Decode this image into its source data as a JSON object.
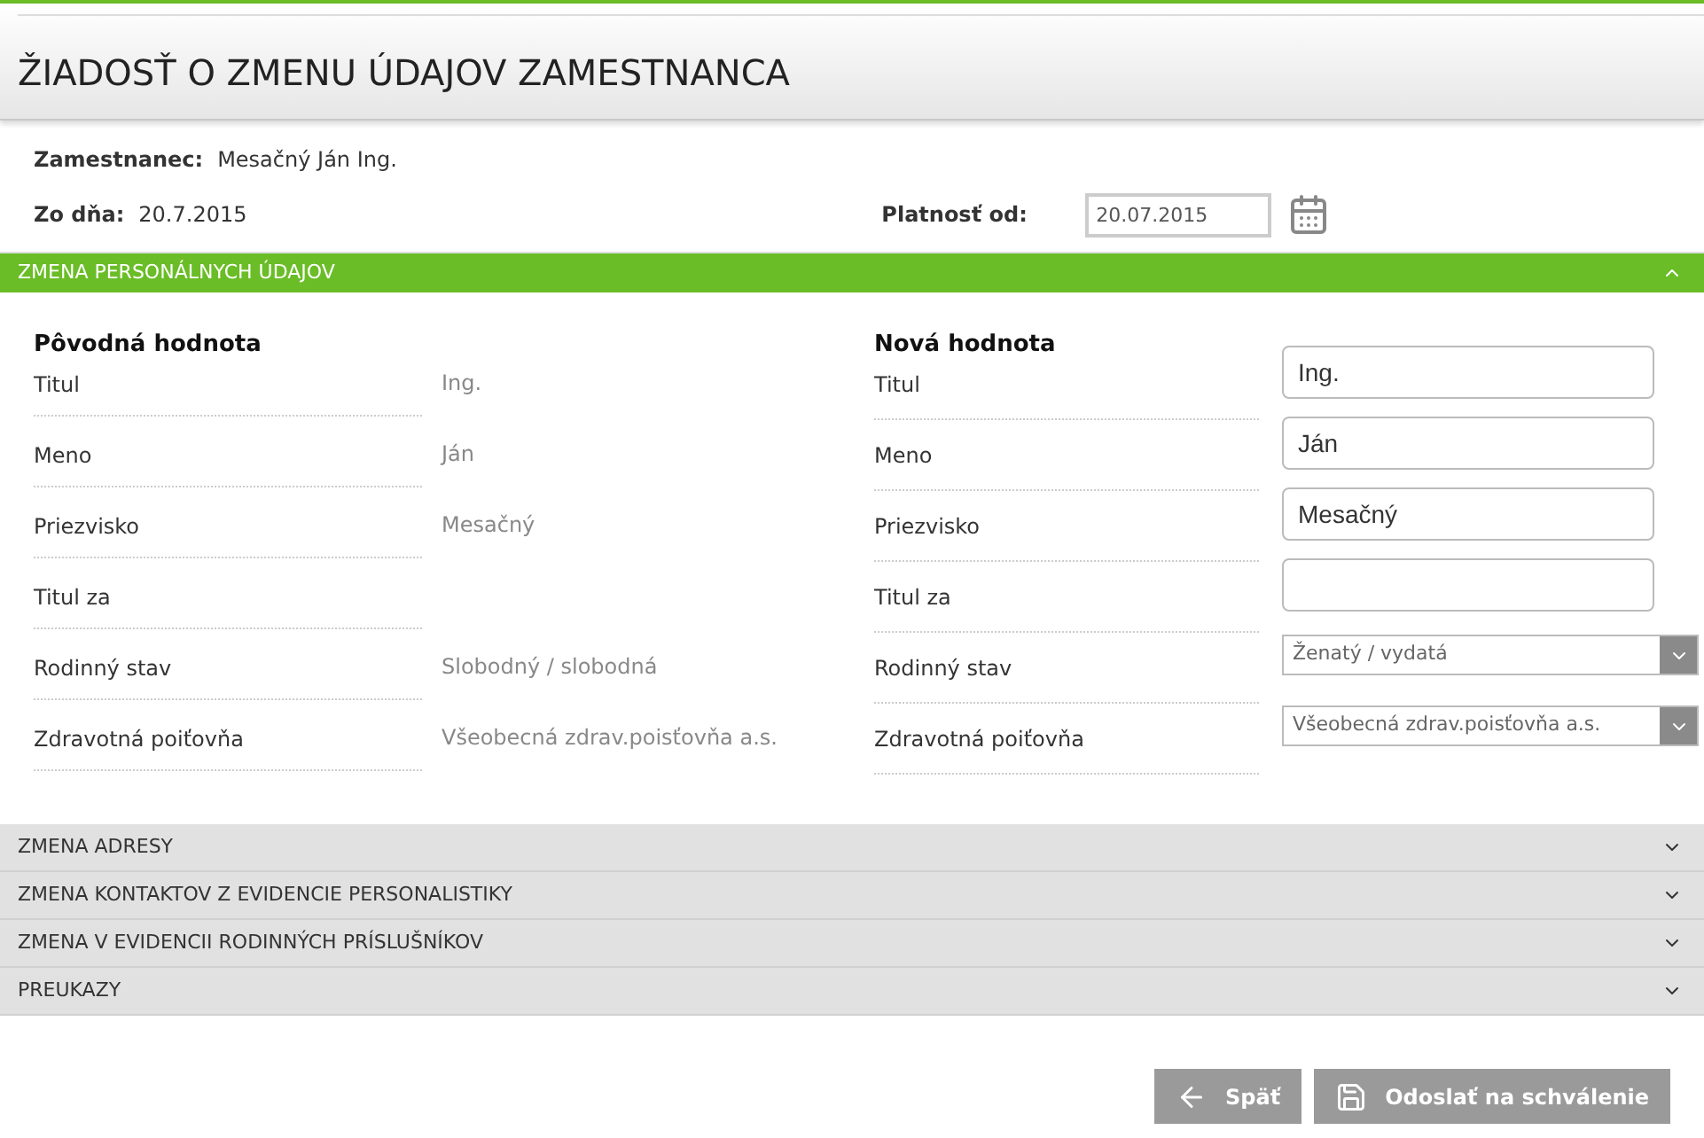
{
  "title": "ŽIADOSŤ O ZMENU ÚDAJOV ZAMESTNANCA",
  "employee": {
    "label": "Zamestnanec:",
    "value": "Mesačný Ján Ing."
  },
  "date": {
    "label": "Zo dňa:",
    "value": "20.7.2015"
  },
  "valid_from": {
    "label": "Platnosť od:",
    "value": "20.07.2015"
  },
  "sections": [
    {
      "title": "ZMENA PERSONÁLNYCH ÚDAJOV",
      "expanded": true,
      "original": {
        "heading": "Pôvodná hodnota",
        "rows": [
          {
            "label": "Titul",
            "value": "Ing."
          },
          {
            "label": "Meno",
            "value": "Ján"
          },
          {
            "label": "Priezvisko",
            "value": "Mesačný"
          },
          {
            "label": "Titul za"
          },
          {
            "label": "Rodinný stav",
            "value": "Slobodný / slobodná"
          },
          {
            "label": "Zdravotná poiťovňa",
            "value": "Všeobecná zdrav.poisťovňa a.s."
          }
        ]
      },
      "new": {
        "heading": "Nová hodnota",
        "rows": [
          {
            "kind": "text",
            "label": "Titul",
            "value": "Ing."
          },
          {
            "kind": "text",
            "label": "Meno",
            "value": "Ján"
          },
          {
            "kind": "text",
            "label": "Priezvisko",
            "value": "Mesačný"
          },
          {
            "kind": "text",
            "label": "Titul za"
          },
          {
            "kind": "select",
            "label": "Rodinný stav",
            "value": "Ženatý / vydatá"
          },
          {
            "kind": "select",
            "label": "Zdravotná poiťovňa",
            "value": "Všeobecná zdrav.poisťovňa a.s."
          }
        ]
      }
    },
    {
      "title": "ZMENA ADRESY",
      "expanded": false
    },
    {
      "title": "ZMENA KONTAKTOV Z EVIDENCIE PERSONALISTIKY",
      "expanded": false
    },
    {
      "title": "ZMENA V EVIDENCII RODINNÝCH PRÍSLUŠNÍKOV",
      "expanded": false
    },
    {
      "title": "PREUKAZY",
      "expanded": false
    }
  ],
  "buttons": [
    {
      "kind": "back",
      "label": "Späť"
    },
    {
      "kind": "save",
      "label": "Odoslať na schválenie"
    }
  ]
}
